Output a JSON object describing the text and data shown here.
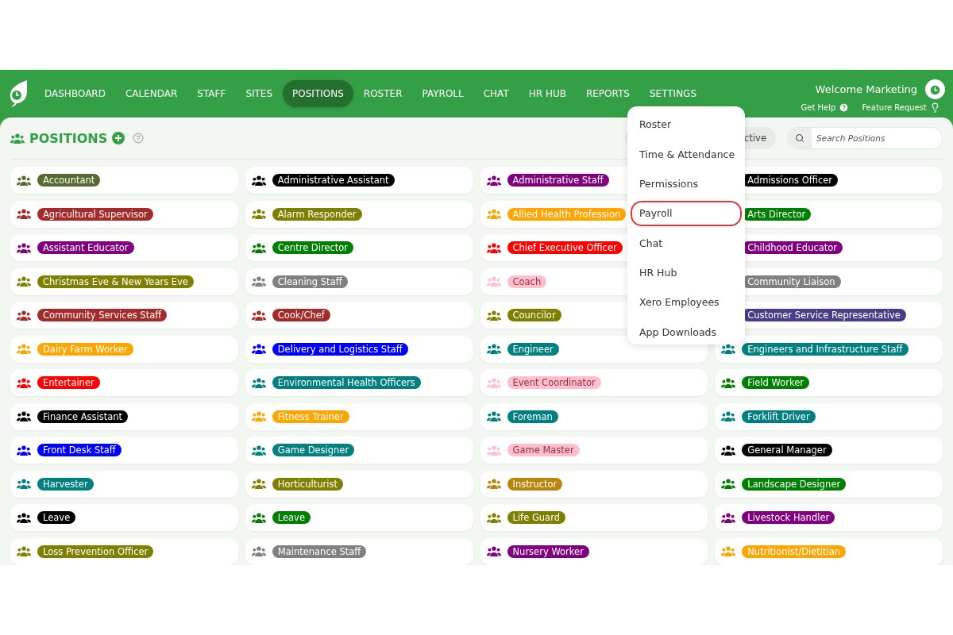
{
  "nav": {
    "items": [
      {
        "label": "DASHBOARD",
        "selected": false
      },
      {
        "label": "CALENDAR",
        "selected": false
      },
      {
        "label": "STAFF",
        "selected": false
      },
      {
        "label": "SITES",
        "selected": false
      },
      {
        "label": "POSITIONS",
        "selected": true
      },
      {
        "label": "ROSTER",
        "selected": false
      },
      {
        "label": "PAYROLL",
        "selected": false
      },
      {
        "label": "CHAT",
        "selected": false
      },
      {
        "label": "HR HUB",
        "selected": false
      },
      {
        "label": "REPORTS",
        "selected": false
      },
      {
        "label": "SETTINGS",
        "selected": false
      }
    ],
    "welcome": "Welcome Marketing",
    "help": "Get Help",
    "feature": "Feature Request"
  },
  "settings_menu": [
    {
      "label": "Roster",
      "highlighted": false
    },
    {
      "label": "Time & Attendance",
      "highlighted": false
    },
    {
      "label": "Permissions",
      "highlighted": false
    },
    {
      "label": "Payroll",
      "highlighted": true
    },
    {
      "label": "Chat",
      "highlighted": false
    },
    {
      "label": "HR Hub",
      "highlighted": false
    },
    {
      "label": "Xero Employees",
      "highlighted": false
    },
    {
      "label": "App Downloads",
      "highlighted": false
    }
  ],
  "page": {
    "title": "POSITIONS",
    "filter": "ctive",
    "search": {
      "placeholder": "Search Positions"
    }
  },
  "positions": [
    {
      "name": "Accountant",
      "color": "#556b2f"
    },
    {
      "name": "Administrative Assistant",
      "color": "#000000"
    },
    {
      "name": "Administrative Staff",
      "color": "#800080"
    },
    {
      "name": "Admissions Officer",
      "color": "#000000"
    },
    {
      "name": "Agricultural Supervisor",
      "color": "#a52a2a"
    },
    {
      "name": "Alarm Responder",
      "color": "#808000"
    },
    {
      "name": "Allied Health Profession",
      "color": "#ffa500"
    },
    {
      "name": "Arts Director",
      "color": "#008000"
    },
    {
      "name": "Assistant Educator",
      "color": "#800080"
    },
    {
      "name": "Centre Director",
      "color": "#008000"
    },
    {
      "name": "Chief Executive Officer",
      "color": "#ff0000"
    },
    {
      "name": "Childhood Educator",
      "color": "#800080"
    },
    {
      "name": "Christmas Eve & New Years Eve",
      "color": "#808000"
    },
    {
      "name": "Cleaning Staff",
      "color": "#808080"
    },
    {
      "name": "Coach",
      "color": "#ffc0cb"
    },
    {
      "name": "Community Liaison",
      "color": "#808080"
    },
    {
      "name": "Community Services Staff",
      "color": "#a52a2a"
    },
    {
      "name": "Cook/Chef",
      "color": "#a52a2a"
    },
    {
      "name": "Councilor",
      "color": "#808000"
    },
    {
      "name": "Customer Service Representative",
      "color": "#483d8b"
    },
    {
      "name": "Dairy Farm Worker",
      "color": "#ffa500"
    },
    {
      "name": "Delivery and Logistics Staff",
      "color": "#0000ff"
    },
    {
      "name": "Engineer",
      "color": "#008080"
    },
    {
      "name": "Engineers and Infrastructure Staff",
      "color": "#008080"
    },
    {
      "name": "Entertainer",
      "color": "#ff0000"
    },
    {
      "name": "Environmental Health Officers",
      "color": "#008080"
    },
    {
      "name": "Event Coordinator",
      "color": "#ffc0cb"
    },
    {
      "name": "Field Worker",
      "color": "#008000"
    },
    {
      "name": "Finance Assistant",
      "color": "#000000"
    },
    {
      "name": "Fitness Trainer",
      "color": "#ffa500"
    },
    {
      "name": "Foreman",
      "color": "#008080"
    },
    {
      "name": "Forklift Driver",
      "color": "#008080"
    },
    {
      "name": "Front Desk Staff",
      "color": "#0000ff"
    },
    {
      "name": "Game Designer",
      "color": "#008080"
    },
    {
      "name": "Game Master",
      "color": "#ffc0cb"
    },
    {
      "name": "General Manager",
      "color": "#000000"
    },
    {
      "name": "Harvester",
      "color": "#008080"
    },
    {
      "name": "Horticulturist",
      "color": "#808000"
    },
    {
      "name": "Instructor",
      "color": "#b8860b"
    },
    {
      "name": "Landscape Designer",
      "color": "#008000"
    },
    {
      "name": "Leave",
      "color": "#000000"
    },
    {
      "name": "Leave",
      "color": "#008000"
    },
    {
      "name": "Life Guard",
      "color": "#808000"
    },
    {
      "name": "Livestock Handler",
      "color": "#800080"
    },
    {
      "name": "Loss Prevention Officer",
      "color": "#808000"
    },
    {
      "name": "Maintenance Staff",
      "color": "#808080"
    },
    {
      "name": "Nursery Worker",
      "color": "#800080"
    },
    {
      "name": "Nutritionist/Dietitian",
      "color": "#ffa500"
    }
  ]
}
